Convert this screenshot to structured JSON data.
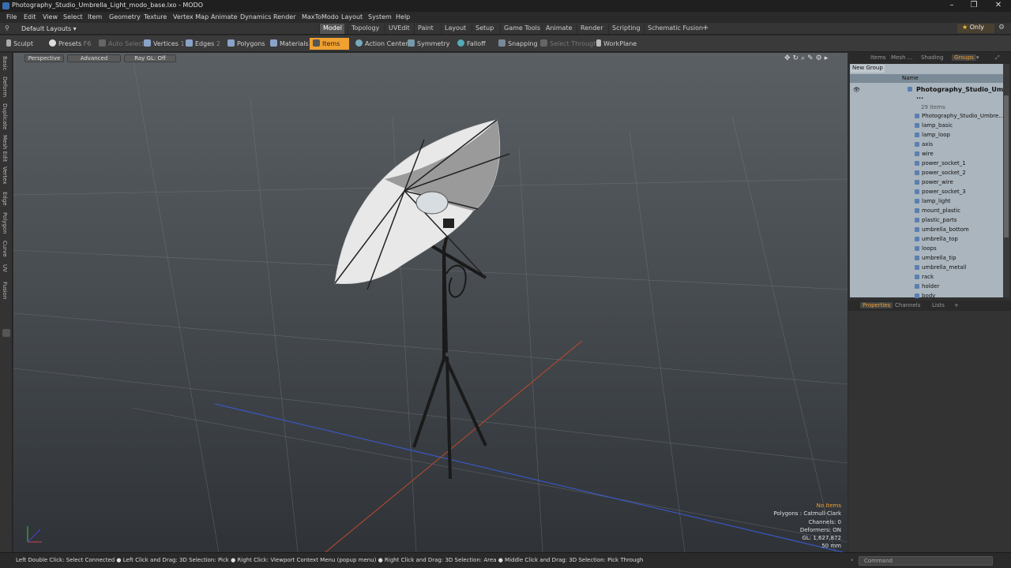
{
  "window": {
    "title": "Photography_Studio_Umbrella_Light_modo_base.lxo - MODO"
  },
  "menu": [
    "File",
    "Edit",
    "View",
    "Select",
    "Item",
    "Geometry",
    "Texture",
    "Vertex Map",
    "Animate",
    "Dynamics",
    "Render",
    "MaxToModo",
    "Layout",
    "System",
    "Help"
  ],
  "layout": {
    "selector": "Default Layouts",
    "tabs": [
      "Model",
      "Topology",
      "UVEdit",
      "Paint",
      "Layout",
      "Setup",
      "Game Tools",
      "Animate",
      "Render",
      "Scripting",
      "Schematic Fusion"
    ],
    "active_tab": "Model",
    "only": "Only"
  },
  "toolbar": {
    "sculpt": "Sculpt",
    "presets": "Presets",
    "presets_key": "F6",
    "auto_select": "Auto Select",
    "vertices": "Vertices",
    "vertices_key": "1",
    "edges": "Edges",
    "edges_key": "2",
    "polygons": "Polygons",
    "materials": "Materials",
    "items": "Items",
    "action_center": "Action Center",
    "symmetry": "Symmetry",
    "falloff": "Falloff",
    "snapping": "Snapping",
    "select_through": "Select Through",
    "workplane": "WorkPlane"
  },
  "left_tabs": [
    "Basic",
    "Deform",
    "Duplicate",
    "Mesh Edit",
    "Vertex",
    "Edge",
    "Polygon",
    "Curve",
    "UV",
    "Fusion"
  ],
  "viewport": {
    "view": "Perspective",
    "shading": "Advanced",
    "raygl": "Ray GL: Off",
    "stats": [
      "No Items",
      "Polygons : Catmull-Clark",
      "Channels: 0",
      "Deformers: ON",
      "GL: 1,627,872",
      "50 mm"
    ]
  },
  "right_panel": {
    "tabs": [
      "Items",
      "Mesh ...",
      "Shading",
      "Groups"
    ],
    "active_tab": "Groups",
    "new_group": "New Group",
    "name_header": "Name",
    "group_name": "Photography_Studio_Um ...",
    "group_count": "29 Items",
    "items": [
      "Photography_Studio_Umbre...",
      "lamp_basic",
      "lamp_loop",
      "axis",
      "wire",
      "power_socket_1",
      "power_socket_2",
      "power_wire",
      "power_socket_3",
      "lamp_light",
      "mount_plastic",
      "plastic_parts",
      "umbrella_bottom",
      "umbrella_top",
      "loops",
      "umbrella_tip",
      "umbrella_metall",
      "rack",
      "holder",
      "body"
    ],
    "prop_tabs": [
      "Properties",
      "Channels",
      "Lists"
    ],
    "prop_active": "Properties"
  },
  "status": {
    "hint": "Left Double Click: Select Connected ● Left Click and Drag: 3D Selection: Pick ● Right Click: Viewport Context Menu (popup menu) ● Right Click and Drag: 3D Selection: Area ● Middle Click and Drag: 3D Selection: Pick Through",
    "command_placeholder": "Command"
  }
}
